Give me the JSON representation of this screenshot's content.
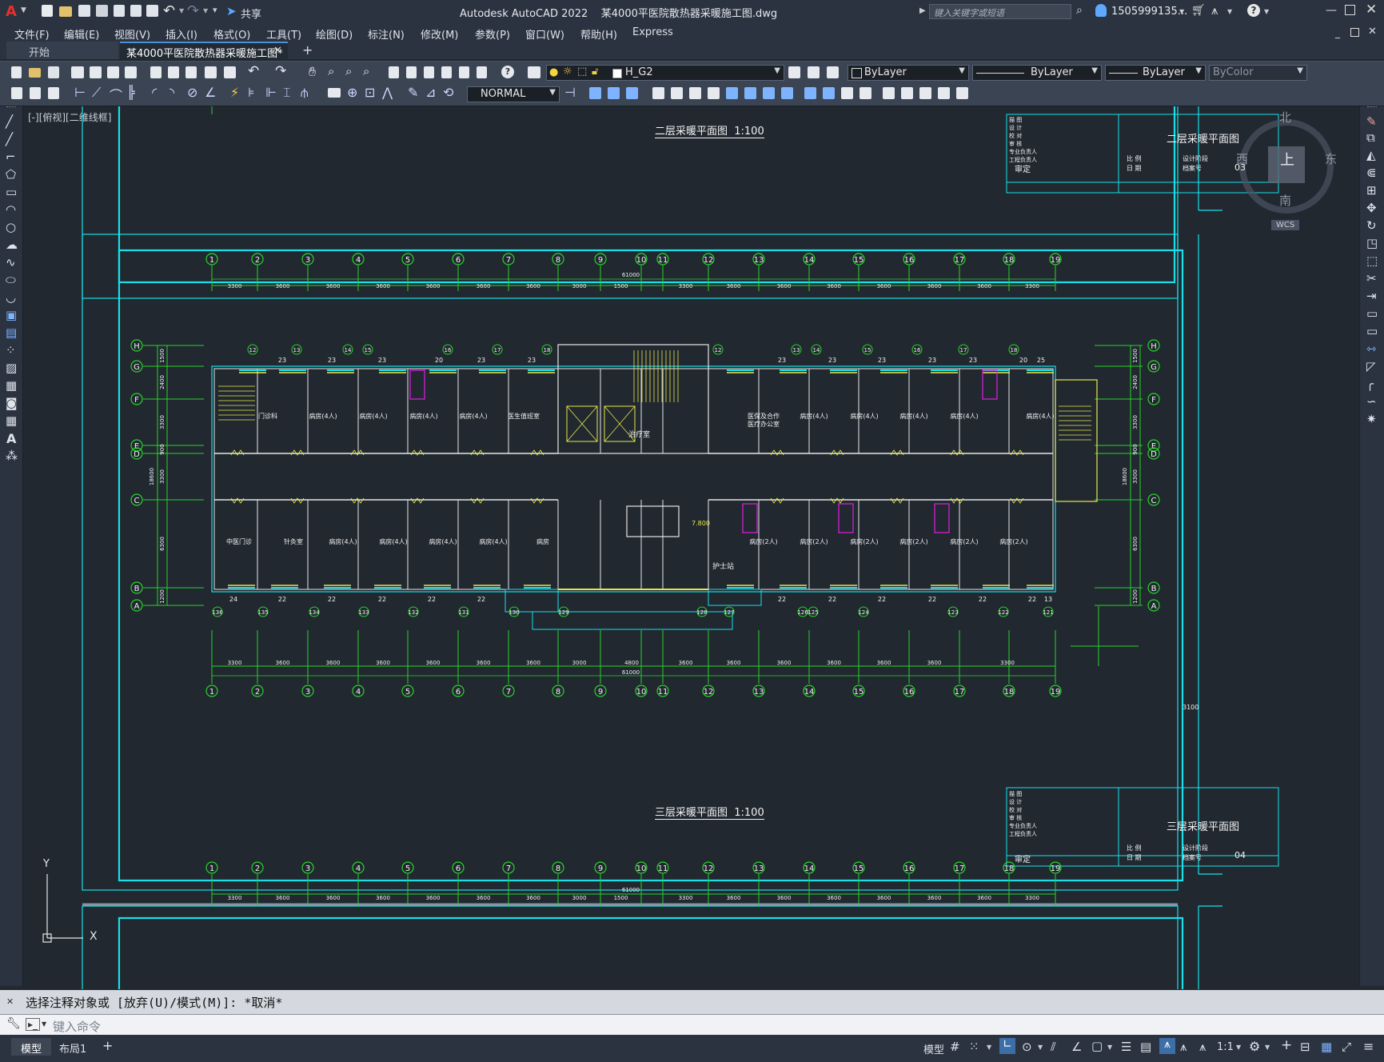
{
  "app": {
    "title": "Autodesk AutoCAD 2022    某4000平医院散热器采暖施工图.dwg",
    "share_label": "共享",
    "search_placeholder": "键入关键字或短语",
    "user": "1505999135...",
    "help": "?"
  },
  "menu": [
    "文件(F)",
    "编辑(E)",
    "视图(V)",
    "插入(I)",
    "格式(O)",
    "工具(T)",
    "绘图(D)",
    "标注(N)",
    "修改(M)",
    "参数(P)",
    "窗口(W)",
    "帮助(H)",
    "Express"
  ],
  "tabs": {
    "start": "开始",
    "doc": "某4000平医院散热器采暖施工图*",
    "close": "✕",
    "add": "+"
  },
  "toolbar": {
    "layer": "H_G2",
    "color": "ByLayer",
    "linetype": "ByLayer",
    "lineweight": "ByLayer",
    "plotstyle": "ByColor",
    "textstyle": "NORMAL"
  },
  "viewport": {
    "label": "[-][俯视][二维线框]",
    "wcs": "WCS"
  },
  "viewcube": {
    "north": "北",
    "south": "南",
    "east": "东",
    "west": "西",
    "top": "上"
  },
  "ucs": {
    "x": "X",
    "y": "Y"
  },
  "drawing": {
    "upper_title": "二层采暖平面图  1:100",
    "middle_title": "三层采暖平面图  1:100",
    "tb_upper_name": "二层采暖平面图",
    "tb_middle_name": "三层采暖平面图",
    "tb_upper_no": "03",
    "tb_middle_no": "04",
    "tb_review": "审定",
    "tb_scale": "比 例",
    "tb_date": "日 期",
    "tb_design_no": "设计阶段",
    "tb_file_no": "档案号",
    "tb_rows": [
      "描 图",
      "设 计",
      "校 对",
      "审 核",
      "专业负责人",
      "工程负责人"
    ],
    "grid_top": [
      "1",
      "2",
      "3",
      "4",
      "5",
      "6",
      "7",
      "8",
      "9",
      "10",
      "11",
      "12",
      "13",
      "14",
      "15",
      "16",
      "17",
      "18",
      "19"
    ],
    "dims_top": [
      "3300",
      "3600",
      "3600",
      "3600",
      "3600",
      "3600",
      "3600",
      "3000",
      "1500",
      "3300",
      "3600",
      "3600",
      "3600",
      "3600",
      "3600",
      "3600",
      "3300"
    ],
    "dims_bottom": [
      "3300",
      "3600",
      "3600",
      "3600",
      "3600",
      "3600",
      "3600",
      "3000",
      "4800",
      "3600",
      "3600",
      "3600",
      "3600",
      "3600",
      "3600",
      "3300"
    ],
    "total_dim": "61000",
    "rows_left": [
      "H",
      "G",
      "F",
      "E",
      "D",
      "C",
      "B",
      "A"
    ],
    "vdims_left": [
      "1500",
      "2400",
      "3300",
      "900",
      "3300",
      "6300",
      "1200"
    ],
    "vtotal": "18600",
    "rooms_north": [
      "门诊科",
      "病房(4人)",
      "病房(4人)",
      "病房(4人)",
      "病房(4人)",
      "医生值班室",
      "医保及合作医疗办公室",
      "病房(4人)",
      "病房(4人)",
      "病房(4人)",
      "病房(4人)",
      "病房(4人)"
    ],
    "rooms_south": [
      "中医门诊",
      "针灸室",
      "病房(4人)",
      "病房(4人)",
      "病房(4人)",
      "病房(4人)",
      "病房",
      "病房(2人)",
      "病房(2人)",
      "病房(2人)",
      "病房(2人)",
      "病房(2人)",
      "病房(2人)"
    ],
    "nurse_station": "护士站",
    "duty_room": "治疗室",
    "level": "7.800",
    "risers_top": [
      "12",
      "13",
      "14",
      "15",
      "16",
      "17",
      "18",
      "12",
      "13",
      "14",
      "15",
      "16",
      "17",
      "18"
    ],
    "loads_top": [
      "23",
      "23",
      "23",
      "20",
      "23",
      "23",
      "23",
      "23",
      "23",
      "23",
      "23",
      "20",
      "25"
    ],
    "loads_bottom": [
      "24",
      "22",
      "22",
      "22",
      "22",
      "22",
      "22",
      "22",
      "22",
      "22",
      "22",
      "22",
      "13"
    ],
    "risers_bottom": [
      "136",
      "135",
      "134",
      "133",
      "132",
      "131",
      "130",
      "129",
      "128",
      "127",
      "126",
      "125",
      "124",
      "123",
      "122",
      "121"
    ],
    "dim_3100": "3100"
  },
  "command": {
    "history": "选择注释对象或 [放弃(U)/模式(M)]: *取消*",
    "prompt": "键入命令"
  },
  "status": {
    "tabs": [
      "模型",
      "布局1"
    ],
    "add": "+",
    "model": "模型",
    "scale": "1:1"
  }
}
